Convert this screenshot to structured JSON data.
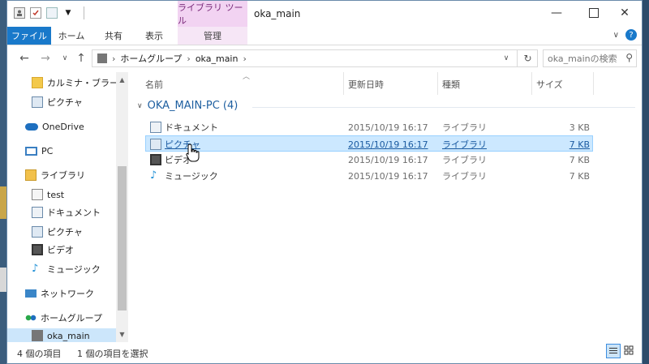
{
  "window": {
    "title": "oka_main",
    "contextual_tab_group": "ライブラリ ツール"
  },
  "ribbon": {
    "tabs": [
      {
        "label": "ファイル"
      },
      {
        "label": "ホーム"
      },
      {
        "label": "共有"
      },
      {
        "label": "表示"
      },
      {
        "label": "管理"
      }
    ]
  },
  "address": {
    "segments": [
      "ホームグループ",
      "oka_main"
    ],
    "search_placeholder": "oka_mainの検索"
  },
  "nav": {
    "items": [
      {
        "label": "カルミナ・ブラーナ",
        "icon": "folder-icon"
      },
      {
        "label": "ピクチャ",
        "icon": "pictures-icon"
      },
      {
        "label": "OneDrive",
        "icon": "onedrive-icon"
      },
      {
        "label": "PC",
        "icon": "pc-icon"
      },
      {
        "label": "ライブラリ",
        "icon": "library-icon"
      },
      {
        "label": "test",
        "icon": "library-item-icon"
      },
      {
        "label": "ドキュメント",
        "icon": "documents-icon"
      },
      {
        "label": "ピクチャ",
        "icon": "pictures-icon"
      },
      {
        "label": "ビデオ",
        "icon": "videos-icon"
      },
      {
        "label": "ミュージック",
        "icon": "music-icon"
      },
      {
        "label": "ネットワーク",
        "icon": "network-icon"
      },
      {
        "label": "ホームグループ",
        "icon": "homegroup-icon"
      },
      {
        "label": "oka_main",
        "icon": "user-icon"
      }
    ]
  },
  "columns": {
    "name": "名前",
    "date": "更新日時",
    "type": "種類",
    "size": "サイズ"
  },
  "group": {
    "title": "OKA_MAIN-PC (4)"
  },
  "files": [
    {
      "name": "ドキュメント",
      "date": "2015/10/19 16:17",
      "type": "ライブラリ",
      "size": "3 KB",
      "icon": "documents-icon"
    },
    {
      "name": "ピクチャ",
      "date": "2015/10/19 16:17",
      "type": "ライブラリ",
      "size": "7 KB",
      "icon": "pictures-icon"
    },
    {
      "name": "ビデオ",
      "date": "2015/10/19 16:17",
      "type": "ライブラリ",
      "size": "7 KB",
      "icon": "videos-icon"
    },
    {
      "name": "ミュージック",
      "date": "2015/10/19 16:17",
      "type": "ライブラリ",
      "size": "7 KB",
      "icon": "music-icon"
    }
  ],
  "status": {
    "item_count": "4 個の項目",
    "selected_count": "1 個の項目を選択"
  }
}
